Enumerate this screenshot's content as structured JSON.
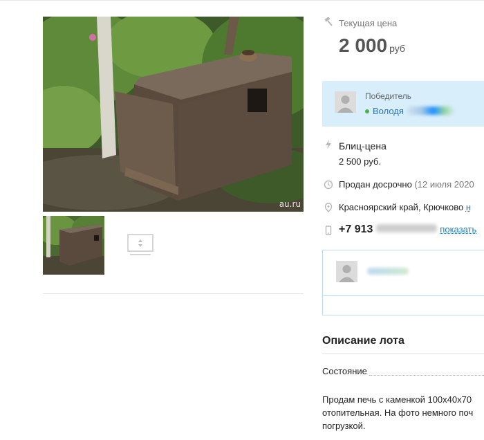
{
  "gallery": {
    "watermark": "au.ru"
  },
  "price": {
    "label": "Текущая цена",
    "amount": "2 000",
    "unit": "руб"
  },
  "winner": {
    "label": "Победитель",
    "name": "Володя"
  },
  "blitz": {
    "label": "Блиц-цена",
    "value": "2 500 руб."
  },
  "sale": {
    "status": "Продан досрочно",
    "date": "(12 июля 2020"
  },
  "location": {
    "text": "Красноярский край, Крючково",
    "link": "н"
  },
  "phone": {
    "number": "+7 913",
    "show_label": "показать"
  },
  "description": {
    "title": "Описание лота",
    "condition_label": "Состояние",
    "text": "Продам печь с каменкой 100х40х70 отопительная. На фото немного поч погрузкой."
  },
  "colors": {
    "accent": "#1c7dc7",
    "winner_bg": "#d8eefb",
    "online": "#4bb34b"
  }
}
